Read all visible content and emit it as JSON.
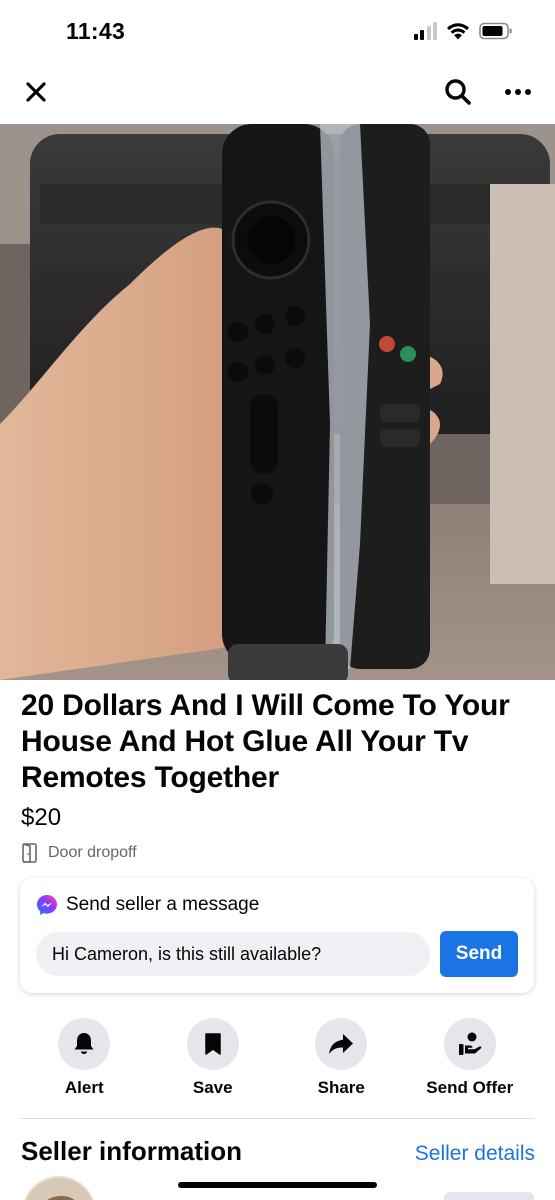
{
  "status_bar": {
    "time": "11:43",
    "icons": [
      "signal-icon",
      "wifi-icon",
      "battery-icon"
    ]
  },
  "nav": {
    "icons": [
      "close-icon",
      "search-icon",
      "more-icon"
    ]
  },
  "listing": {
    "title": "20 Dollars And I Will Come To Your House And Hot Glue All Your Tv Remotes Together",
    "price": "$20",
    "delivery": "Door dropoff",
    "delivery_icon": "door-icon"
  },
  "message": {
    "header": "Send seller a message",
    "header_icon": "messenger-icon",
    "input_value": "Hi Cameron, is this still available?",
    "send_label": "Send"
  },
  "actions": [
    {
      "label": "Alert",
      "icon": "bell-icon"
    },
    {
      "label": "Save",
      "icon": "bookmark-icon"
    },
    {
      "label": "Share",
      "icon": "share-arrow-icon"
    },
    {
      "label": "Send Offer",
      "icon": "offer-hand-icon"
    }
  ],
  "seller": {
    "title": "Seller information",
    "details_link": "Seller details"
  },
  "colors": {
    "accent": "#1b74e4",
    "secondary_text": "#65676b",
    "button_gray": "#e4e6eb"
  }
}
